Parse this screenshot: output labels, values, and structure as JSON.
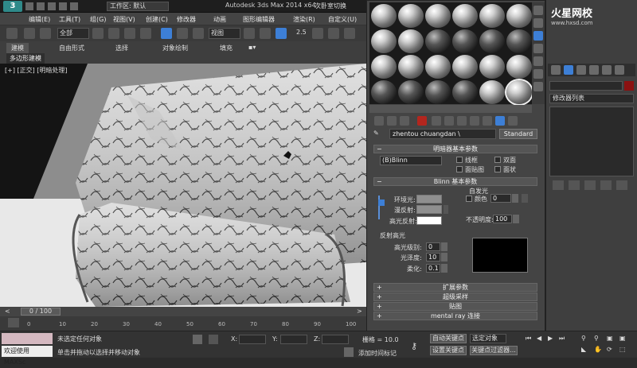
{
  "window": {
    "logo": "3",
    "workspace_label": "工作区: 默认",
    "app_title": "Autodesk 3ds Max  2014 x64",
    "save_note": "次卧室切换"
  },
  "menu": [
    "编辑(E)",
    "工具(T)",
    "组(G)",
    "视图(V)",
    "创建(C)",
    "修改器",
    "动画",
    "图形编辑器",
    "渲染(R)",
    "自定义(U)"
  ],
  "toolbar": {
    "selection_filter": "全部",
    "reference_coord": "视图",
    "snap_value": "2.5"
  },
  "ribbon": {
    "tabs": [
      "建模",
      "自由形式",
      "选择",
      "对象绘制",
      "填充"
    ],
    "active_tab": "建模",
    "sub_label": "多边形建模"
  },
  "viewport": {
    "label": "[+] [正交] [明暗处理]"
  },
  "timeline": {
    "frame": "0 / 100",
    "ticks": [
      "0",
      "10",
      "20",
      "30",
      "40",
      "50",
      "60",
      "70",
      "80",
      "90",
      "100"
    ]
  },
  "status": {
    "maxscript": "",
    "welcome": "欢迎使用 MAXSc",
    "line1": "未选定任何对象",
    "line2": "单击并拖动以选择并移动对象",
    "x_label": "X:",
    "y_label": "Y:",
    "z_label": "Z:",
    "grid": "栅格 = 10.0",
    "add_tag": "添加时间标记",
    "auto_key": "自动关键点",
    "selected": "选定对象",
    "set_key": "设置关键点",
    "key_filters": "关键点过滤器..."
  },
  "material_editor": {
    "material_name": "zhentou  chuangdan \\",
    "material_type": "Standard",
    "shader_rollout": "明暗器基本参数",
    "shader": "(B)Blinn",
    "shader_options": [
      "线框",
      "双面",
      "面贴图",
      "面状"
    ],
    "blinn_rollout": "Blinn 基本参数",
    "self_illum_label": "自发光",
    "color_label": "颜色",
    "color_value": "0",
    "ambient_label": "环境光:",
    "diffuse_label": "漫反射:",
    "specular_label": "高光反射:",
    "opacity_label": "不透明度:",
    "opacity_value": "100",
    "highlights_label": "反射高光",
    "spec_level_label": "高光级别:",
    "spec_level_value": "0",
    "gloss_label": "光泽度:",
    "gloss_value": "10",
    "soften_label": "柔化:",
    "soften_value": "0.1",
    "rollouts": [
      "扩展参数",
      "超级采样",
      "贴图",
      "mental ray 连接"
    ]
  },
  "command_panel": {
    "watermark": "火星网校",
    "watermark_url": "www.hxsd.com",
    "modifier_list": "修改器列表"
  },
  "colors": {
    "ambient": "#8f8f8f",
    "diffuse": "#8f8f8f",
    "specular": "#ffffff",
    "object_color": "#8b1111"
  }
}
